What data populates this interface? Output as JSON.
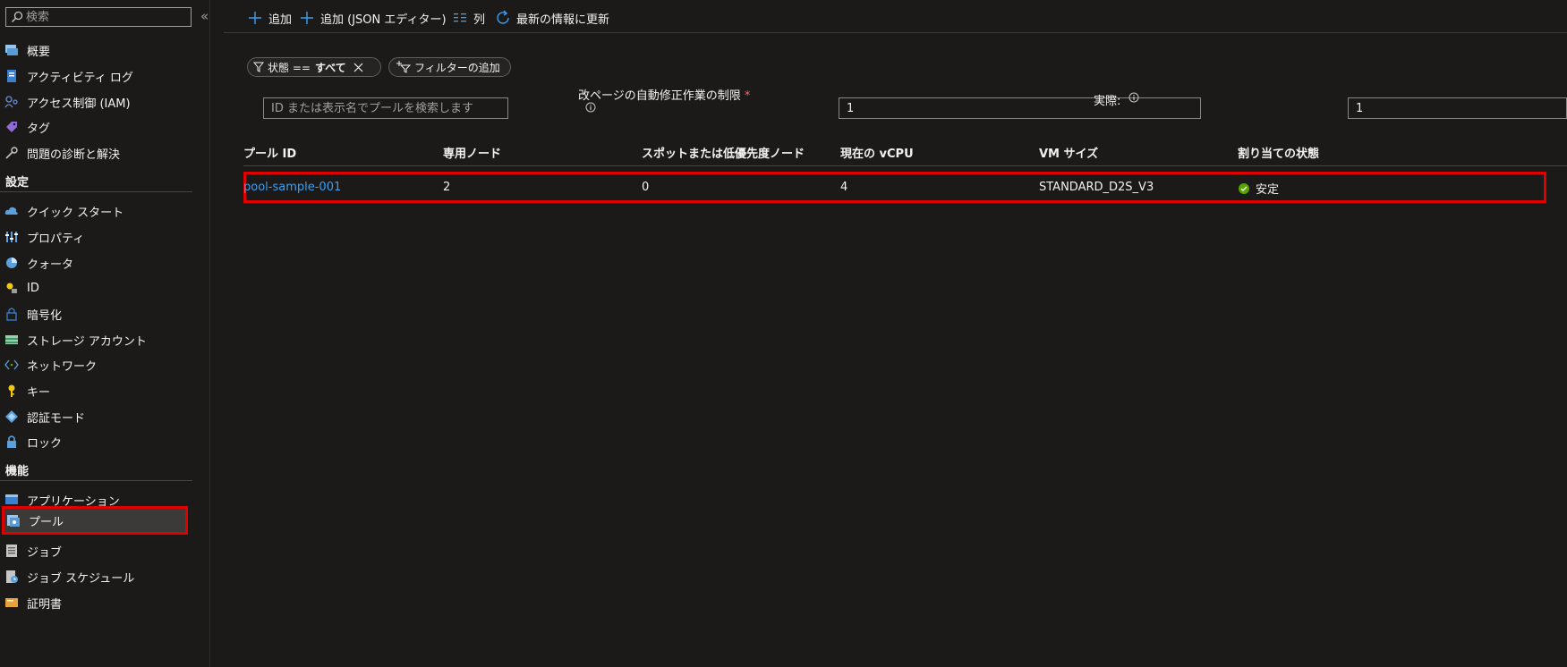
{
  "sidebar": {
    "search_placeholder": "検索",
    "collapse_glyph": "«",
    "items_top": [
      {
        "label": "概要",
        "icon": "overview-icon"
      },
      {
        "label": "アクティビティ ログ",
        "icon": "activity-log-icon"
      },
      {
        "label": "アクセス制御 (IAM)",
        "icon": "iam-icon"
      },
      {
        "label": "タグ",
        "icon": "tag-icon"
      },
      {
        "label": "問題の診断と解決",
        "icon": "wrench-icon"
      }
    ],
    "section_settings": "設定",
    "items_settings": [
      {
        "label": "クイック スタート",
        "icon": "cloud-icon"
      },
      {
        "label": "プロパティ",
        "icon": "properties-icon"
      },
      {
        "label": "クォータ",
        "icon": "quota-icon"
      },
      {
        "label": "ID",
        "icon": "identity-icon"
      },
      {
        "label": "暗号化",
        "icon": "lock-outline-icon"
      },
      {
        "label": "ストレージ アカウント",
        "icon": "storage-icon"
      },
      {
        "label": "ネットワーク",
        "icon": "network-icon"
      },
      {
        "label": "キー",
        "icon": "key-icon"
      },
      {
        "label": "認証モード",
        "icon": "auth-mode-icon"
      },
      {
        "label": "ロック",
        "icon": "lock-icon"
      }
    ],
    "section_features": "機能",
    "items_features": [
      {
        "label": "アプリケーション",
        "icon": "application-icon"
      },
      {
        "label": "プール",
        "icon": "pool-icon",
        "selected": true
      },
      {
        "label": "ジョブ",
        "icon": "job-icon"
      },
      {
        "label": "ジョブ スケジュール",
        "icon": "job-schedule-icon"
      },
      {
        "label": "証明書",
        "icon": "certificate-icon"
      }
    ]
  },
  "toolbar": {
    "add_label": "追加",
    "add_json_label": "追加 (JSON エディター)",
    "columns_label": "列",
    "refresh_label": "最新の情報に更新"
  },
  "filters": {
    "state_label": "状態 ==",
    "state_value": "すべて",
    "add_filter_label": "フィルターの追加",
    "pool_search_placeholder": "ID または表示名でプールを検索します",
    "auto_repair_limit_label": "改ページの自動修正作業の制限",
    "required_mark": "*",
    "auto_repair_limit_value": "1",
    "actual_label": "実際:",
    "actual_value": "1"
  },
  "table": {
    "columns": [
      "プール ID",
      "専用ノード",
      "スポットまたは低優先度ノード",
      "現在の vCPU",
      "VM サイズ",
      "割り当ての状態"
    ],
    "rows": [
      {
        "pool_id": "pool-sample-001",
        "dedicated_nodes": "2",
        "spot_nodes": "0",
        "current_vcpu": "4",
        "vm_size": "STANDARD_D2S_V3",
        "allocation_state": "安定"
      }
    ]
  },
  "colors": {
    "accent": "#3aa0f3",
    "highlight": "#e00000",
    "success": "#57a300",
    "background": "#1b1a19"
  }
}
